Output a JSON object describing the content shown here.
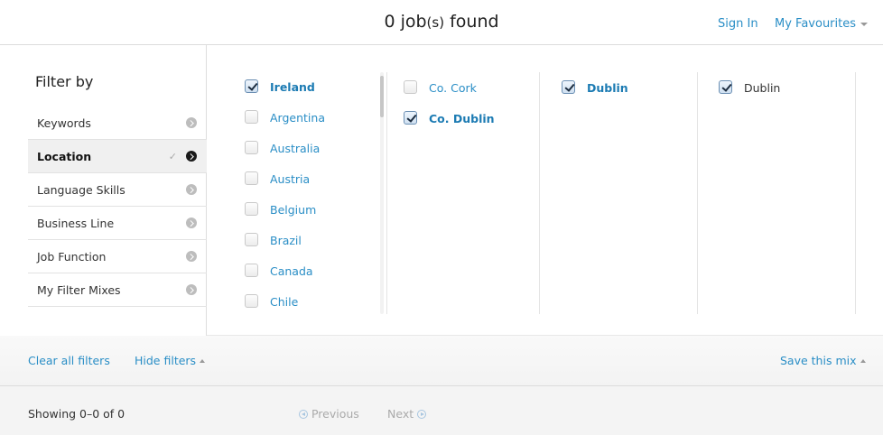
{
  "header": {
    "title_count": "0 job",
    "title_suffix_small": "(s)",
    "title_rest": " found",
    "sign_in": "Sign In",
    "my_favourites": "My Favourites"
  },
  "sidebar": {
    "title": "Filter by",
    "items": [
      {
        "label": "Keywords",
        "active": false
      },
      {
        "label": "Location",
        "active": true,
        "tick": "✓"
      },
      {
        "label": "Language Skills",
        "active": false
      },
      {
        "label": "Business Line",
        "active": false
      },
      {
        "label": "Job Function",
        "active": false
      },
      {
        "label": "My Filter Mixes",
        "active": false
      }
    ]
  },
  "location": {
    "countries": [
      {
        "label": "Ireland",
        "checked": true
      },
      {
        "label": "Argentina",
        "checked": false
      },
      {
        "label": "Australia",
        "checked": false
      },
      {
        "label": "Austria",
        "checked": false
      },
      {
        "label": "Belgium",
        "checked": false
      },
      {
        "label": "Brazil",
        "checked": false
      },
      {
        "label": "Canada",
        "checked": false
      },
      {
        "label": "Chile",
        "checked": false
      }
    ],
    "counties": [
      {
        "label": "Co. Cork",
        "checked": false
      },
      {
        "label": "Co. Dublin",
        "checked": true
      }
    ],
    "cities": [
      {
        "label": "Dublin",
        "checked": true
      }
    ],
    "offices": [
      {
        "label": "Dublin",
        "checked": true
      }
    ]
  },
  "actions": {
    "clear_all": "Clear all filters",
    "hide_filters": "Hide filters",
    "save_mix": "Save this mix"
  },
  "footer": {
    "showing": "Showing 0–0 of 0",
    "previous": "Previous",
    "next": "Next"
  }
}
